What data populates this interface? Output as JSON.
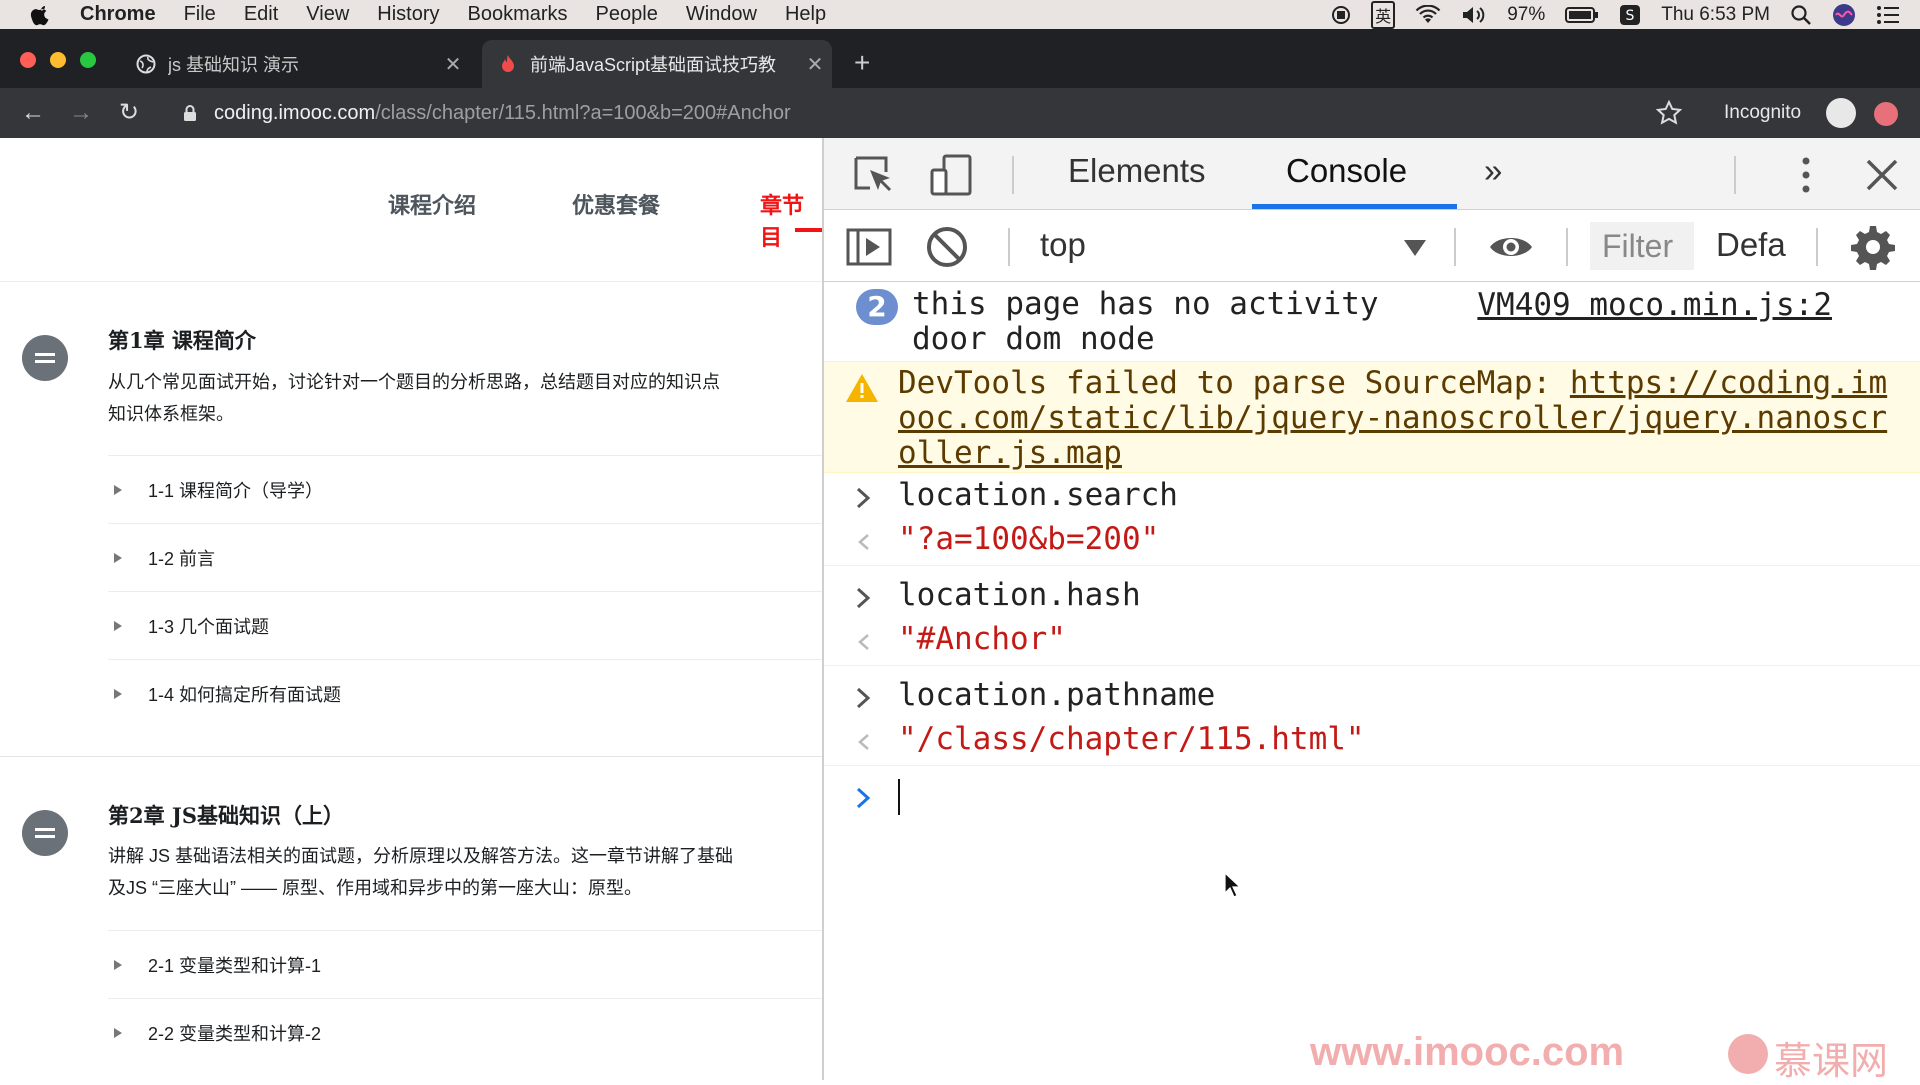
{
  "menubar": {
    "items": [
      "Chrome",
      "File",
      "Edit",
      "View",
      "History",
      "Bookmarks",
      "People",
      "Window",
      "Help"
    ],
    "ime": "英",
    "battery": "97%",
    "clock": "Thu 6:53 PM"
  },
  "tabs": [
    {
      "title": "js 基础知识 演示",
      "active": false
    },
    {
      "title": "前端JavaScript基础面试技巧教",
      "active": true
    }
  ],
  "address": {
    "host": "coding.imooc.com",
    "rest": "/class/chapter/115.html?a=100&b=200#Anchor",
    "incognito_label": "Incognito"
  },
  "page": {
    "nav": [
      "课程介绍",
      "优惠套餐",
      "章节目"
    ],
    "chapters": [
      {
        "title": "第1章 课程简介",
        "desc_line1": "从几个常见面试开始，讨论针对一个题目的分析思路，总结题目对应的知识点",
        "desc_line2": "知识体系框架。",
        "lessons": [
          "1-1 课程简介（导学）",
          "1-2 前言",
          "1-3 几个面试题",
          "1-4 如何搞定所有面试题"
        ]
      },
      {
        "title": "第2章 JS基础知识（上）",
        "desc_line1": "讲解 JS 基础语法相关的面试题，分析原理以及解答方法。这一章节讲解了基础",
        "desc_line2": "及JS “三座大山” —— 原型、作用域和异步中的第一座大山：原型。",
        "lessons": [
          "2-1 变量类型和计算-1",
          "2-2 变量类型和计算-2"
        ]
      }
    ]
  },
  "devtools": {
    "tabs": [
      "Elements",
      "Console",
      "»"
    ],
    "context": "top",
    "filter_placeholder": "Filter",
    "levels": "Defa",
    "messages": {
      "info_count": "2",
      "info_line1": "this page has no activity",
      "info_line2": "door dom node",
      "info_source": "VM409 moco.min.js:2",
      "warn_prefix": "DevTools failed to parse SourceMap: ",
      "warn_link": "https://coding.imooc.com/static/lib/jquery-nanoscroller/jquery.nanoscroller.js.map",
      "cmd1": "location.search",
      "res1": "\"?a=100&b=200\"",
      "cmd2": "location.hash",
      "res2": "\"#Anchor\"",
      "cmd3": "location.pathname",
      "res3": "\"/class/chapter/115.html\""
    }
  },
  "watermark": {
    "url": "www.imooc.com",
    "brand": "慕课网"
  },
  "colors": {
    "accent_red": "#f01414",
    "devtools_blue": "#1a73e8",
    "string_red": "#c41a16",
    "warn_bg": "#fffbe5"
  }
}
